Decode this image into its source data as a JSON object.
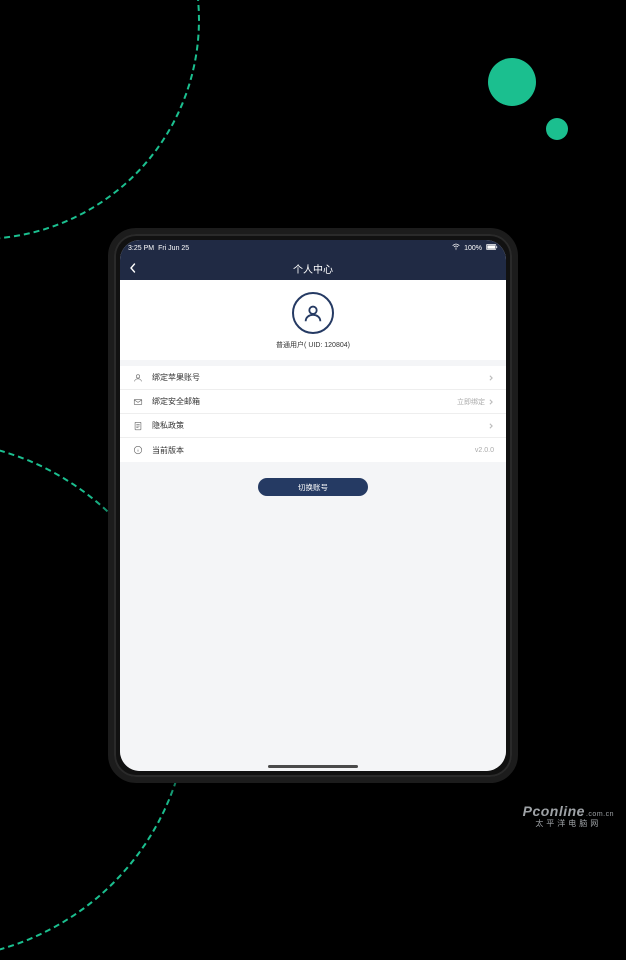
{
  "statusbar": {
    "time": "3:25 PM",
    "date": "Fri Jun 25",
    "battery": "100%"
  },
  "navbar": {
    "title": "个人中心"
  },
  "profile": {
    "user_type": "普通用户",
    "uid_label": "UID",
    "uid": "120804"
  },
  "menu": {
    "bind_apple": {
      "label": "绑定苹果账号"
    },
    "bind_mail": {
      "label": "绑定安全邮箱",
      "tail": "立即绑定"
    },
    "privacy": {
      "label": "隐私政策"
    },
    "version": {
      "label": "当前版本",
      "tail": "v2.0.0"
    }
  },
  "switch_btn": "切换账号",
  "watermark": {
    "brand": "Pconline",
    "suffix": ".com.cn",
    "tagline": "太平洋电脑网"
  }
}
